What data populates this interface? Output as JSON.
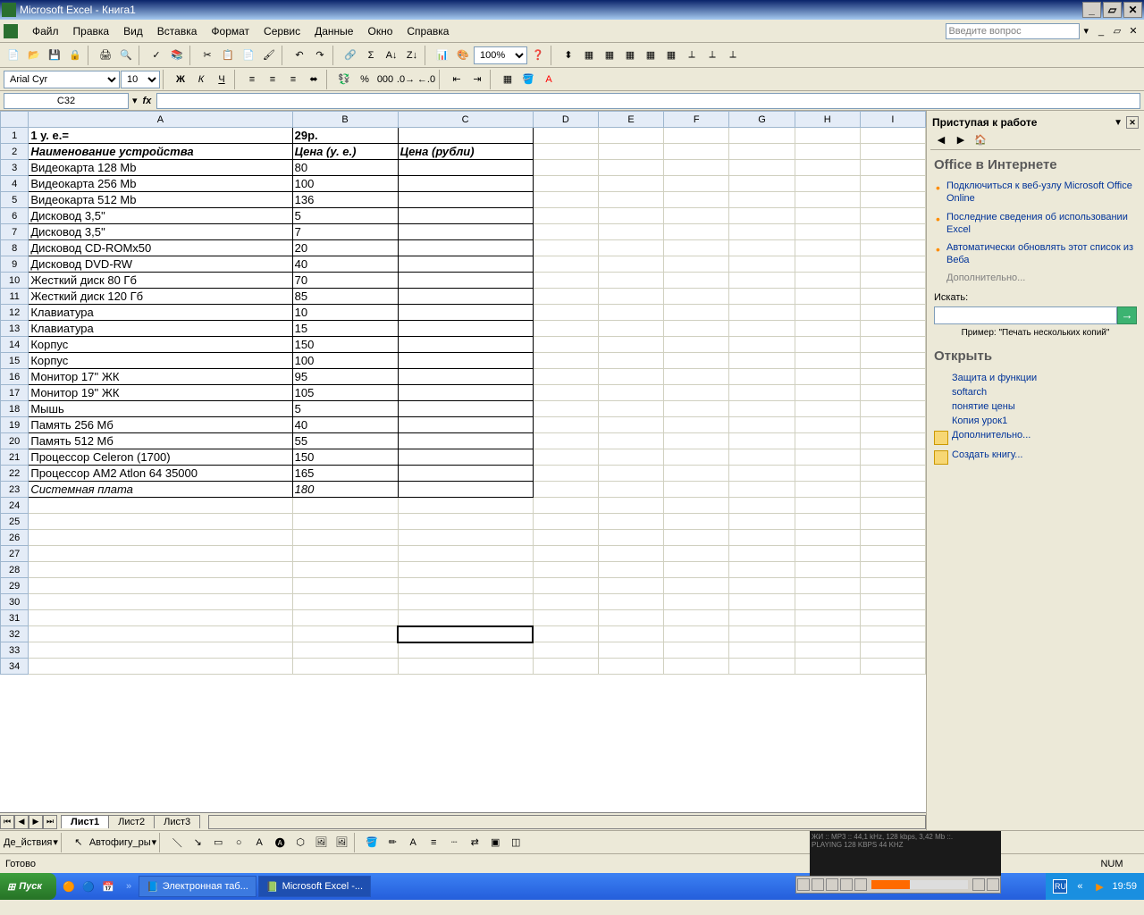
{
  "title": "Microsoft Excel - Книга1",
  "menu": [
    "Файл",
    "Правка",
    "Вид",
    "Вставка",
    "Формат",
    "Сервис",
    "Данные",
    "Окно",
    "Справка"
  ],
  "ask_placeholder": "Введите вопрос",
  "font_name": "Arial Cyr",
  "font_size": "10",
  "zoom": "100%",
  "name_box": "C32",
  "columns": [
    "A",
    "B",
    "C",
    "D",
    "E",
    "F",
    "G",
    "H",
    "I"
  ],
  "headers": {
    "A": "1 у. е.=",
    "B": "29р."
  },
  "col_headers": {
    "A": "Наименование устройства",
    "B": "Цена (у. е.)",
    "C": "Цена (рубли)"
  },
  "rows": [
    {
      "a": "Видеокарта 128 Mb",
      "b": "80"
    },
    {
      "a": "Видеокарта 256 Mb",
      "b": "100"
    },
    {
      "a": "Видеокарта  512 Mb",
      "b": "136"
    },
    {
      "a": "Дисковод 3,5''",
      "b": "5"
    },
    {
      "a": "Дисковод 3,5''",
      "b": "7"
    },
    {
      "a": "Дисковод CD-ROMx50",
      "b": "20"
    },
    {
      "a": "Дисковод DVD-RW",
      "b": "40"
    },
    {
      "a": "Жесткий диск 80 Гб",
      "b": "70"
    },
    {
      "a": "Жесткий диск 120 Гб",
      "b": "85"
    },
    {
      "a": "Клавиатура",
      "b": "10"
    },
    {
      "a": "Клавиатура",
      "b": "15"
    },
    {
      "a": "Корпус",
      "b": "150"
    },
    {
      "a": "Корпус",
      "b": "100"
    },
    {
      "a": "Монитор 17'' ЖК",
      "b": "95"
    },
    {
      "a": "Монитор 19'' ЖК",
      "b": "105"
    },
    {
      "a": "Мышь",
      "b": "5"
    },
    {
      "a": "Память 256 Мб",
      "b": "40"
    },
    {
      "a": "Память 512 Мб",
      "b": "55"
    },
    {
      "a": "Процессор Celeron (1700)",
      "b": "150"
    },
    {
      "a": "Процессор AM2 Atlon 64 35000",
      "b": "165"
    },
    {
      "a": "Системная плата",
      "b": "180",
      "italic": true
    }
  ],
  "empty_rows": 11,
  "sheets": [
    "Лист1",
    "Лист2",
    "Лист3"
  ],
  "active_sheet": 0,
  "taskpane": {
    "title": "Приступая к работе",
    "section1": "Office в Интернете",
    "links1": [
      "Подключиться к веб-узлу Microsoft Office Online",
      "Последние сведения об использовании Excel",
      "Автоматически обновлять этот список из Веба"
    ],
    "more": "Дополнительно...",
    "search_label": "Искать:",
    "example": "Пример: \"Печать нескольких копий\"",
    "open_h": "Открыть",
    "recent": [
      "Защита и функции",
      "softarch",
      "понятие цены",
      "Копия урок1"
    ],
    "more2": "Дополнительно...",
    "new_book": "Создать книгу..."
  },
  "drawbar": {
    "actions": "Де_йствия",
    "autoshapes": "Автофигу_ры"
  },
  "status": {
    "ready": "Готово",
    "num": "NUM"
  },
  "player": {
    "line1": "ЖИ :: MP3 :: 44,1 kHz, 128 kbps, 3,42 Mb ::.",
    "line2": "PLAYING   128 KBPS   44 KHZ"
  },
  "taskbar": {
    "start": "Пуск",
    "tasks": [
      {
        "label": "Электронная таб...",
        "active": false
      },
      {
        "label": "Microsoft Excel -...",
        "active": true
      }
    ],
    "lang": "RU",
    "time": "19:59"
  }
}
